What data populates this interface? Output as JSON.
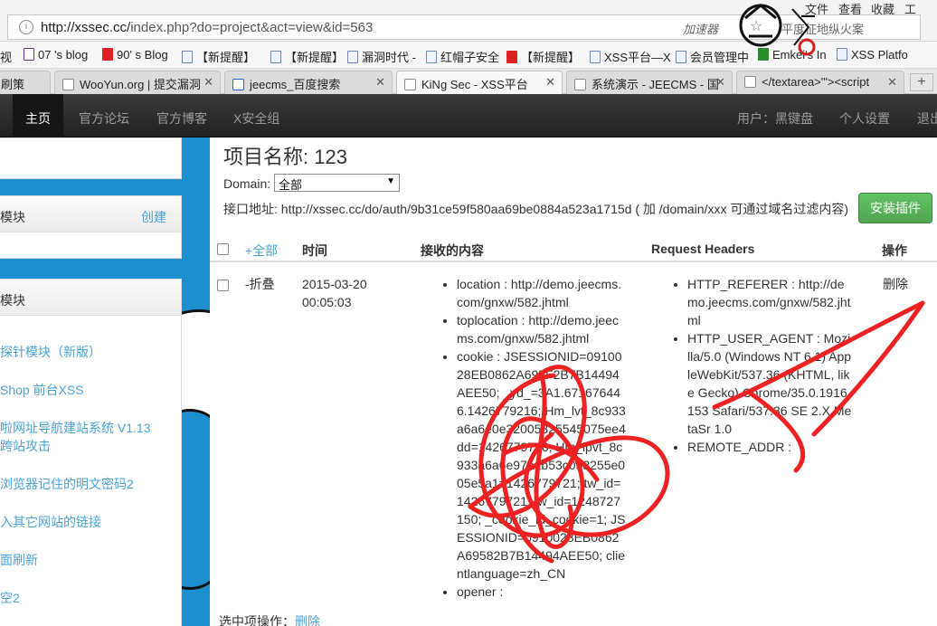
{
  "browser": {
    "url_prefix": "http://xssec.cc/",
    "url_rest": "index.php?do=project&act=view&id=563",
    "accelerator": "加速器",
    "search_hint": "平度征地纵火案",
    "menu_file": "文件",
    "menu_view": "查看",
    "menu_fav": "收藏",
    "menu_tools": "工",
    "bookmarks": [
      {
        "label": "视"
      },
      {
        "label": "07 's blog"
      },
      {
        "label": "90' s Blog"
      },
      {
        "label": "【新提醒】"
      },
      {
        "label": "【新提醒】"
      },
      {
        "label": "漏洞时代 -"
      },
      {
        "label": "红帽子安全"
      },
      {
        "label": "【新提醒】"
      },
      {
        "label": "XSS平台—X"
      },
      {
        "label": "会员管理中"
      },
      {
        "label": "Emkei's In"
      },
      {
        "label": "XSS Platfo"
      }
    ],
    "tabs": [
      {
        "label": "刷策"
      },
      {
        "label": "WooYun.org | 提交漏洞"
      },
      {
        "label": "jeecms_百度搜索"
      },
      {
        "label": "KiNg Sec - XSS平台"
      },
      {
        "label": "系统演示 - JEECMS - 国"
      },
      {
        "label": "</textarea>'\"><script"
      }
    ]
  },
  "nav": {
    "home": "主页",
    "forum": "官方论坛",
    "blog": "官方博客",
    "xgroup": "X安全组",
    "user": "用户：黑键盘",
    "settings": "个人设置",
    "logout": "退出"
  },
  "sidebar": {
    "panel1_title": "模块",
    "panel1_action": "创建",
    "panel2_title": "模块",
    "links": [
      "探针模块（新版）",
      "Shop 前台XSS",
      "啦网址导航建站系统 V1.13",
      "跨站攻击",
      "浏览器记住的明文密码2",
      "入其它网站的链接",
      "面刷新",
      "空2"
    ]
  },
  "main": {
    "project_title": "项目名称: 123",
    "domain_label": "Domain:",
    "domain_value": "全部",
    "api_text": "接口地址: http://xssec.cc/do/auth/9b31ce59f580aa69be0884a523a1715d ( 加 /domain/xxx 可通过域名过滤内容)",
    "install_button": "安装插件",
    "columns": {
      "select_all": "+全部",
      "time": "时间",
      "content": "接收的内容",
      "headers": "Request Headers",
      "actions": "操作"
    },
    "row": {
      "toggle": "-折叠",
      "date": "2015-03-20",
      "time": "00:05:03",
      "content": [
        "location : http://demo.jeecms.com/gnxw/582.jhtml",
        "toplocation : http://demo.jeecms.com/gnxw/582.jhtml",
        "cookie : JSESSIONID=0910028EB0862A695F2B7B14494AEE50; _yd_=3A1.671676446.1426779216; Hm_lvt_8c933a6a6e0e32005325545075ee4dd=1426779716; Hm_lpvt_8c933a6a6e97a1b53c053255e005e5a1=1426779721; tw_id=1426779721; tw_id=1248727150; _cookie_id_cookie=1; JSESSIONID=0910028EB0862A69582B7B14494AEE50; clientlanguage=zh_CN",
        "opener :"
      ],
      "headers": [
        "HTTP_REFERER : http://demo.jeecms.com/gnxw/582.jhtml",
        "HTTP_USER_AGENT : Mozilla/5.0 (Windows NT 6.1) AppleWebKit/537.36 (KHTML, like Gecko) Chrome/35.0.1916.153 Safari/537.36 SE 2.X MetaSr 1.0",
        "REMOTE_ADDR :"
      ],
      "delete": "删除"
    },
    "bulk_label": "选中项操作：",
    "bulk_delete": "删除"
  }
}
